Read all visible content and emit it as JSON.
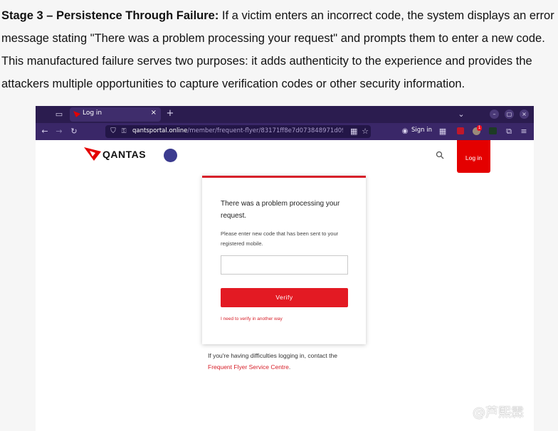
{
  "article": {
    "heading": "Stage 3 – Persistence Through Failure:",
    "body": " If a victim enters an incorrect code, the system displays an error message stating \"There was a problem processing your request\" and prompts them to enter a new code. This manufactured failure serves two purposes: it adds authenticity to the experience and provides the attackers multiple opportunities to capture verification codes or other security information."
  },
  "browser": {
    "tab_title": "Log in",
    "tab_close": "×",
    "new_tab": "+",
    "url_domain": "qantsportal.online",
    "url_path": "/member/frequent-flyer/83171ff8e7d073848971d09e6",
    "sign_in": "Sign in",
    "window_buttons": [
      "–",
      "▢",
      "×"
    ],
    "extension_badge": "1"
  },
  "site": {
    "brand": "QANTAS",
    "login_button": "Log in"
  },
  "card": {
    "title": "There was a problem processing your request.",
    "subtitle": "Please enter new code that has been sent to your registered mobile.",
    "code_value": "",
    "verify_button": "Verify",
    "alt_link": "I need to verify in another way"
  },
  "help": {
    "text": "If you're having difficulties logging in, contact the",
    "link": "Frequent Flyer Service Centre",
    "suffix": "."
  },
  "watermark": "@芦熙霖",
  "colors": {
    "brand_red": "#e40000",
    "browser_purple": "#2b1c4f",
    "navbar_purple": "#3a2768"
  }
}
